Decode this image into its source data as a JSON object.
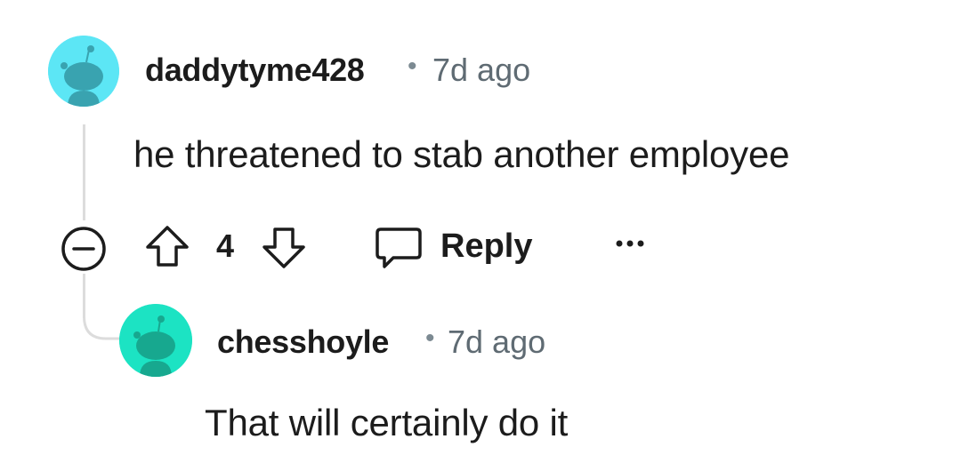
{
  "comments": [
    {
      "username": "daddytyme428",
      "separator": "•",
      "time": "7d ago",
      "body": "he threatened to stab another employee",
      "score": "4",
      "avatar_color": "#5ce6f5",
      "avatar_fg": "#39a3b0"
    },
    {
      "username": "chesshoyle",
      "separator": "•",
      "time": "7d ago",
      "body": "That will certainly do it",
      "avatar_color": "#1ce3c3",
      "avatar_fg": "#17a88f"
    }
  ],
  "actions": {
    "reply_label": "Reply",
    "more_label": "•••"
  },
  "icons": {
    "collapse": "minus-circle-icon",
    "upvote": "arrow-up-icon",
    "downvote": "arrow-down-icon",
    "reply": "speech-bubble-icon",
    "more": "ellipsis-icon"
  }
}
